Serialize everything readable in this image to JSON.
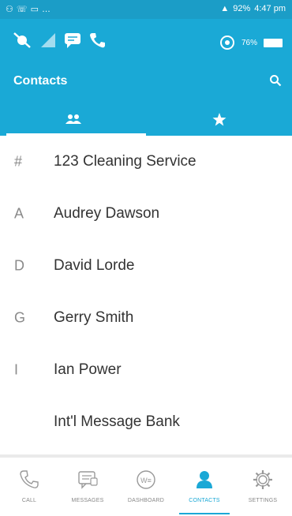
{
  "status": {
    "time": "4:47 pm",
    "battery": "92%"
  },
  "system": {
    "battery_pct": "76%"
  },
  "header": {
    "title": "Contacts"
  },
  "contacts": [
    {
      "letter": "#",
      "name": "123 Cleaning Service"
    },
    {
      "letter": "A",
      "name": "Audrey Dawson"
    },
    {
      "letter": "D",
      "name": "David Lorde"
    },
    {
      "letter": "G",
      "name": "Gerry Smith"
    },
    {
      "letter": "I",
      "name": "Ian Power"
    },
    {
      "letter": "",
      "name": "Int'l Message Bank"
    }
  ],
  "nav": {
    "call": "CALL",
    "messages": "MESSAGES",
    "dashboard": "DASHBOARD",
    "contacts": "CONTACTS",
    "settings": "SETTINGS"
  },
  "colors": {
    "accent": "#1aa9d6",
    "status_bar": "#1b9dc7"
  }
}
